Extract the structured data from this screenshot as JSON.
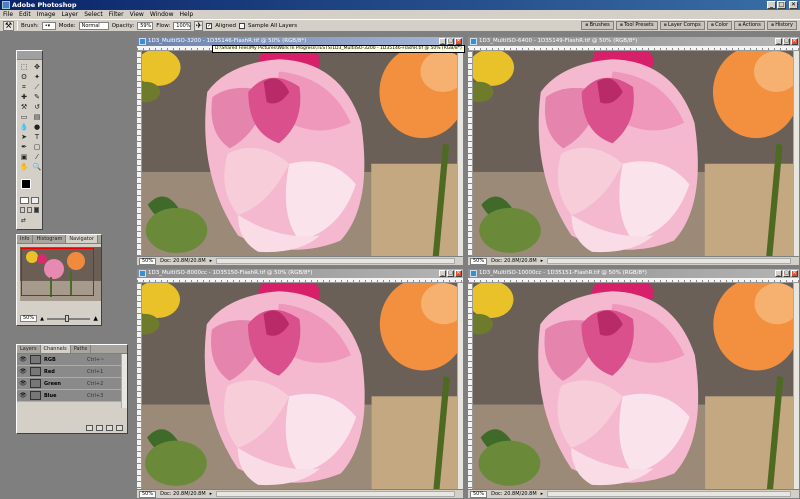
{
  "app": {
    "title": "Adobe Photoshop",
    "window_buttons": {
      "minimize": "_",
      "maximize": "□",
      "close": "✕"
    }
  },
  "menu": [
    "File",
    "Edit",
    "Image",
    "Layer",
    "Select",
    "Filter",
    "View",
    "Window",
    "Help"
  ],
  "options_bar": {
    "brush_label": "Brush:",
    "mode_label": "Mode:",
    "mode_value": "Normal",
    "opacity_label": "Opacity:",
    "opacity_value": "59%",
    "flow_label": "Flow:",
    "flow_value": "100%",
    "aligned_label": "Aligned",
    "sample_all_label": "Sample All Layers"
  },
  "palette_well": [
    "Brushes",
    "Tool Presets",
    "Layer Comps",
    "Color",
    "Actions",
    "History"
  ],
  "navigator": {
    "tabs": [
      "Info",
      "Histogram",
      "Navigator"
    ],
    "zoom": "50%"
  },
  "channels": {
    "tabs": [
      "Layers",
      "Channels",
      "Paths"
    ],
    "rows": [
      {
        "name": "RGB",
        "shortcut": "Ctrl+~"
      },
      {
        "name": "Red",
        "shortcut": "Ctrl+1"
      },
      {
        "name": "Green",
        "shortcut": "Ctrl+2"
      },
      {
        "name": "Blue",
        "shortcut": "Ctrl+3"
      }
    ]
  },
  "documents": [
    {
      "title": "1D3_MultiISO-3200 - 1D35146-FlashR.tif @ 50% (RGB/8*)",
      "zoom": "50%",
      "doc_size": "Doc: 20.8M/20.8M",
      "active": true
    },
    {
      "title": "1D3_MultiISO-6400 - 1D35149-FlashR.tif @ 50% (RGB/8*)",
      "zoom": "50%",
      "doc_size": "Doc: 20.8M/20.8M",
      "active": false
    },
    {
      "title": "1D3_MultiISO-8000cc - 1D35150-FlashR.tif @ 50% (RGB/8*)",
      "zoom": "50%",
      "doc_size": "Doc: 20.8M/20.8M",
      "active": false
    },
    {
      "title": "1D3_MultiISO-10000cc - 1D35151-FlashR.tif @ 50% (RGB/8*)",
      "zoom": "50%",
      "doc_size": "Doc: 20.8M/20.8M",
      "active": false
    }
  ],
  "path_tooltip": "D:\\Shared Files\\My Pictures\\Work In Progress\\TESTS\\1D3_MultiISO-3200 - 1D35146-FlashR.tif @ 50% (RGB/8*)"
}
